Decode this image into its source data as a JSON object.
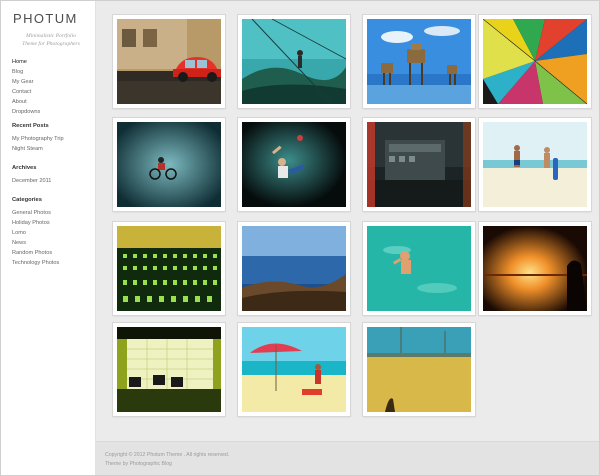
{
  "site": {
    "title": "PHOTUM",
    "tagline_1": "Minimalistic Portfolio",
    "tagline_2": "Theme for Photographers"
  },
  "nav": {
    "items": [
      {
        "label": "Home",
        "active": true
      },
      {
        "label": "Blog"
      },
      {
        "label": "My Gear"
      },
      {
        "label": "Contact"
      },
      {
        "label": "About"
      },
      {
        "label": "Dropdowns"
      }
    ]
  },
  "recent_posts": {
    "title": "Recent Posts",
    "items": [
      "My Photography Trip",
      "Night Steam"
    ]
  },
  "archives": {
    "title": "Archives",
    "items": [
      "December 2011"
    ]
  },
  "categories": {
    "title": "Categories",
    "items": [
      "General Photos",
      "Holiday Photos",
      "Lomo",
      "News",
      "Random Photos",
      "Technology Photos"
    ]
  },
  "gallery": {
    "photos": [
      {
        "icon": "red-car-photo-icon"
      },
      {
        "icon": "rock-climber-photo-icon"
      },
      {
        "icon": "sea-forts-photo-icon"
      },
      {
        "icon": "umbrella-photo-icon"
      },
      {
        "icon": "tricycle-photo-icon"
      },
      {
        "icon": "jumping-man-photo-icon"
      },
      {
        "icon": "machine-photo-icon"
      },
      {
        "icon": "beach-couple-photo-icon"
      },
      {
        "icon": "mixing-desk-photo-icon"
      },
      {
        "icon": "coastline-photo-icon"
      },
      {
        "icon": "swimmer-photo-icon"
      },
      {
        "icon": "sunset-photo-icon"
      },
      {
        "icon": "tiled-wall-photo-icon"
      },
      {
        "icon": "beach-umbrella-photo-icon"
      },
      {
        "icon": "yellow-field-photo-icon"
      }
    ]
  },
  "footer": {
    "copyright": "Copyright © 2012 Photum Theme . All rights reserved.",
    "credit": "Theme by Photographic Blog"
  }
}
